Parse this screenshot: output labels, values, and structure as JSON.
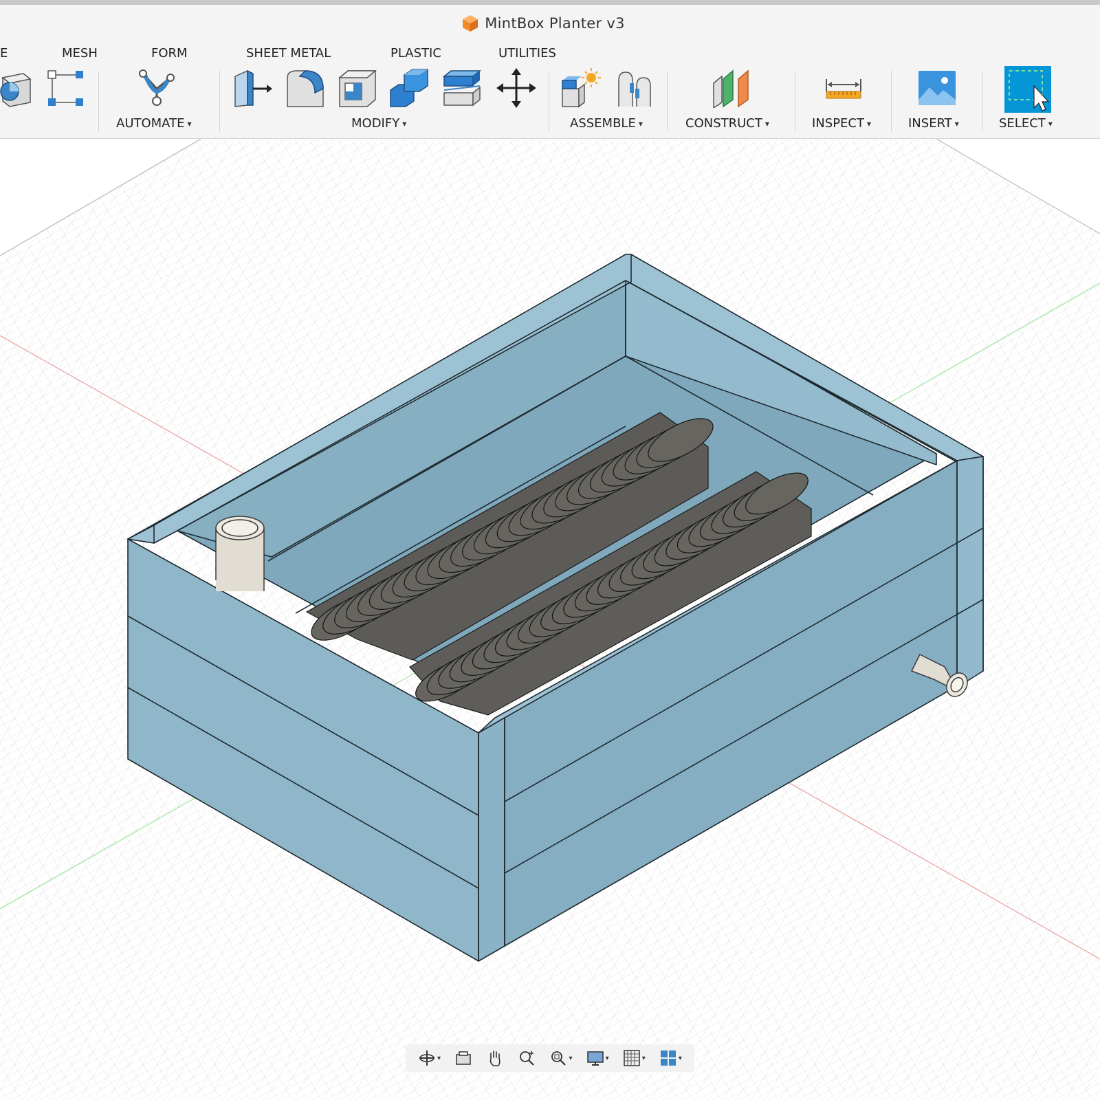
{
  "window": {
    "title": "MintBox Planter v3"
  },
  "tabs": [
    {
      "label": "E"
    },
    {
      "label": "MESH"
    },
    {
      "label": "FORM"
    },
    {
      "label": "SHEET METAL"
    },
    {
      "label": "PLASTIC"
    },
    {
      "label": "UTILITIES"
    }
  ],
  "toolbar": {
    "groups": [
      {
        "label": "AUTOMATE"
      },
      {
        "label": "MODIFY"
      },
      {
        "label": "ASSEMBLE"
      },
      {
        "label": "CONSTRUCT"
      },
      {
        "label": "INSPECT"
      },
      {
        "label": "INSERT"
      },
      {
        "label": "SELECT"
      }
    ],
    "caret": "▾"
  },
  "colors": {
    "accent": "#0696d7",
    "body_blue": "#8fb6c9",
    "coil_dark": "#5b5a57",
    "pipe": "#e2ddd3",
    "grid": "#d8d8d8",
    "x_axis": "#e36b6b",
    "y_axis": "#6ad46a"
  },
  "navbar": {
    "icons": [
      "orbit-icon",
      "look-at-icon",
      "pan-icon",
      "zoom-icon",
      "fit-icon",
      "display-settings-icon",
      "grid-settings-icon",
      "viewports-icon"
    ]
  }
}
